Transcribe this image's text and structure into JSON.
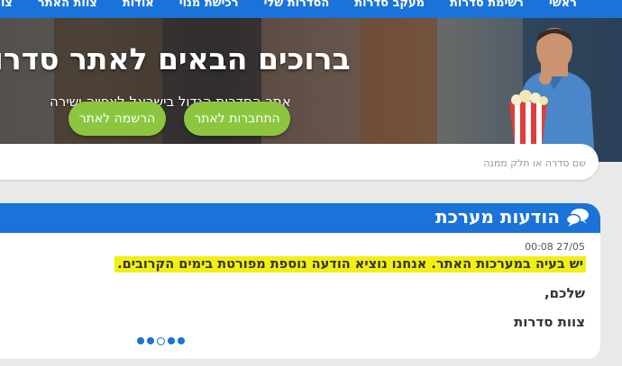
{
  "nav": {
    "items": [
      "ראשי",
      "רשימת סדרות",
      "מעקב סדרות",
      "הסדרות שלי",
      "רכישת מנוי",
      "אודות",
      "צוות האתר",
      "צור קשר"
    ]
  },
  "hero": {
    "title": "ברוכים הבאים לאתר סדרות",
    "subtitle": "אתר הסדרות הגדול בישראל לצפייה ישירה",
    "login_label": "התחברות לאתר",
    "register_label": "הרשמה לאתר"
  },
  "search": {
    "placeholder": "שם סדרה או חלק ממנה"
  },
  "announcements": {
    "title": "הודעות מערכת",
    "date": "27/05 00:08",
    "message": "יש בעיה במערכות האתר. אנחנו נוציא הודעה נוספת מפורטת בימים הקרובים.",
    "greeting": "שלכם,",
    "signature": "צוות סדרות",
    "slides_total": 5,
    "active_slide": 3
  },
  "colors": {
    "primary": "#1a73d9",
    "accent_green": "#8cc63f",
    "highlight": "#f2ef13"
  }
}
